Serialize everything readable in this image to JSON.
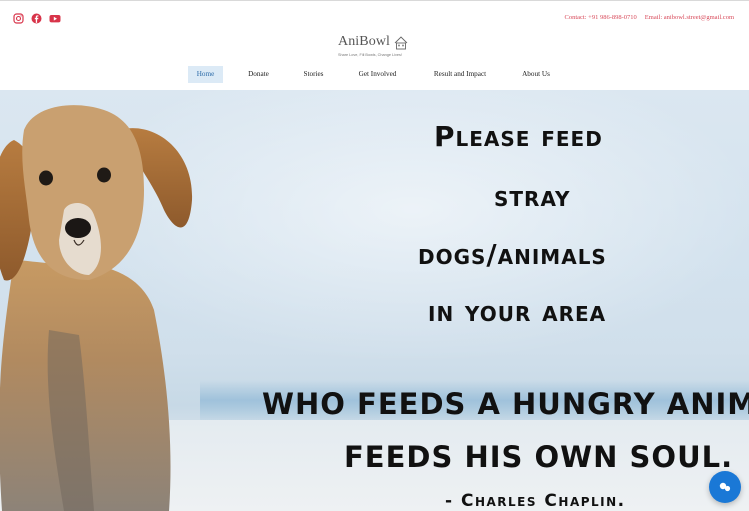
{
  "social": {
    "icons": [
      "instagram-icon",
      "facebook-icon",
      "youtube-icon"
    ],
    "color": "#d8344a"
  },
  "contact": {
    "phone": "Contact: +91 986-898-0710",
    "email": "Email: anibowl.street@gmail.com"
  },
  "logo": {
    "name": "AniBowl",
    "tagline": "Share Love, Fill Bowls, Change Lives!"
  },
  "nav": {
    "items": [
      {
        "label": "Home",
        "active": true
      },
      {
        "label": "Donate",
        "active": false
      },
      {
        "label": "Stories",
        "active": false
      },
      {
        "label": "Get Involved",
        "active": false
      },
      {
        "label": "Result and Impact",
        "active": false
      },
      {
        "label": "About Us",
        "active": false
      }
    ]
  },
  "hero": {
    "line1": "Please feed",
    "line2": "stray",
    "line3": "dogs/animals",
    "line4": "in your area",
    "quote1": "WHO FEEDS A HUNGRY ANIMAL,",
    "quote2": "FEEDS HIS OWN SOUL.",
    "author": "- Charles Chaplin."
  },
  "chat": {
    "icon": "chat-bubbles-icon",
    "color": "#1a78d6"
  }
}
